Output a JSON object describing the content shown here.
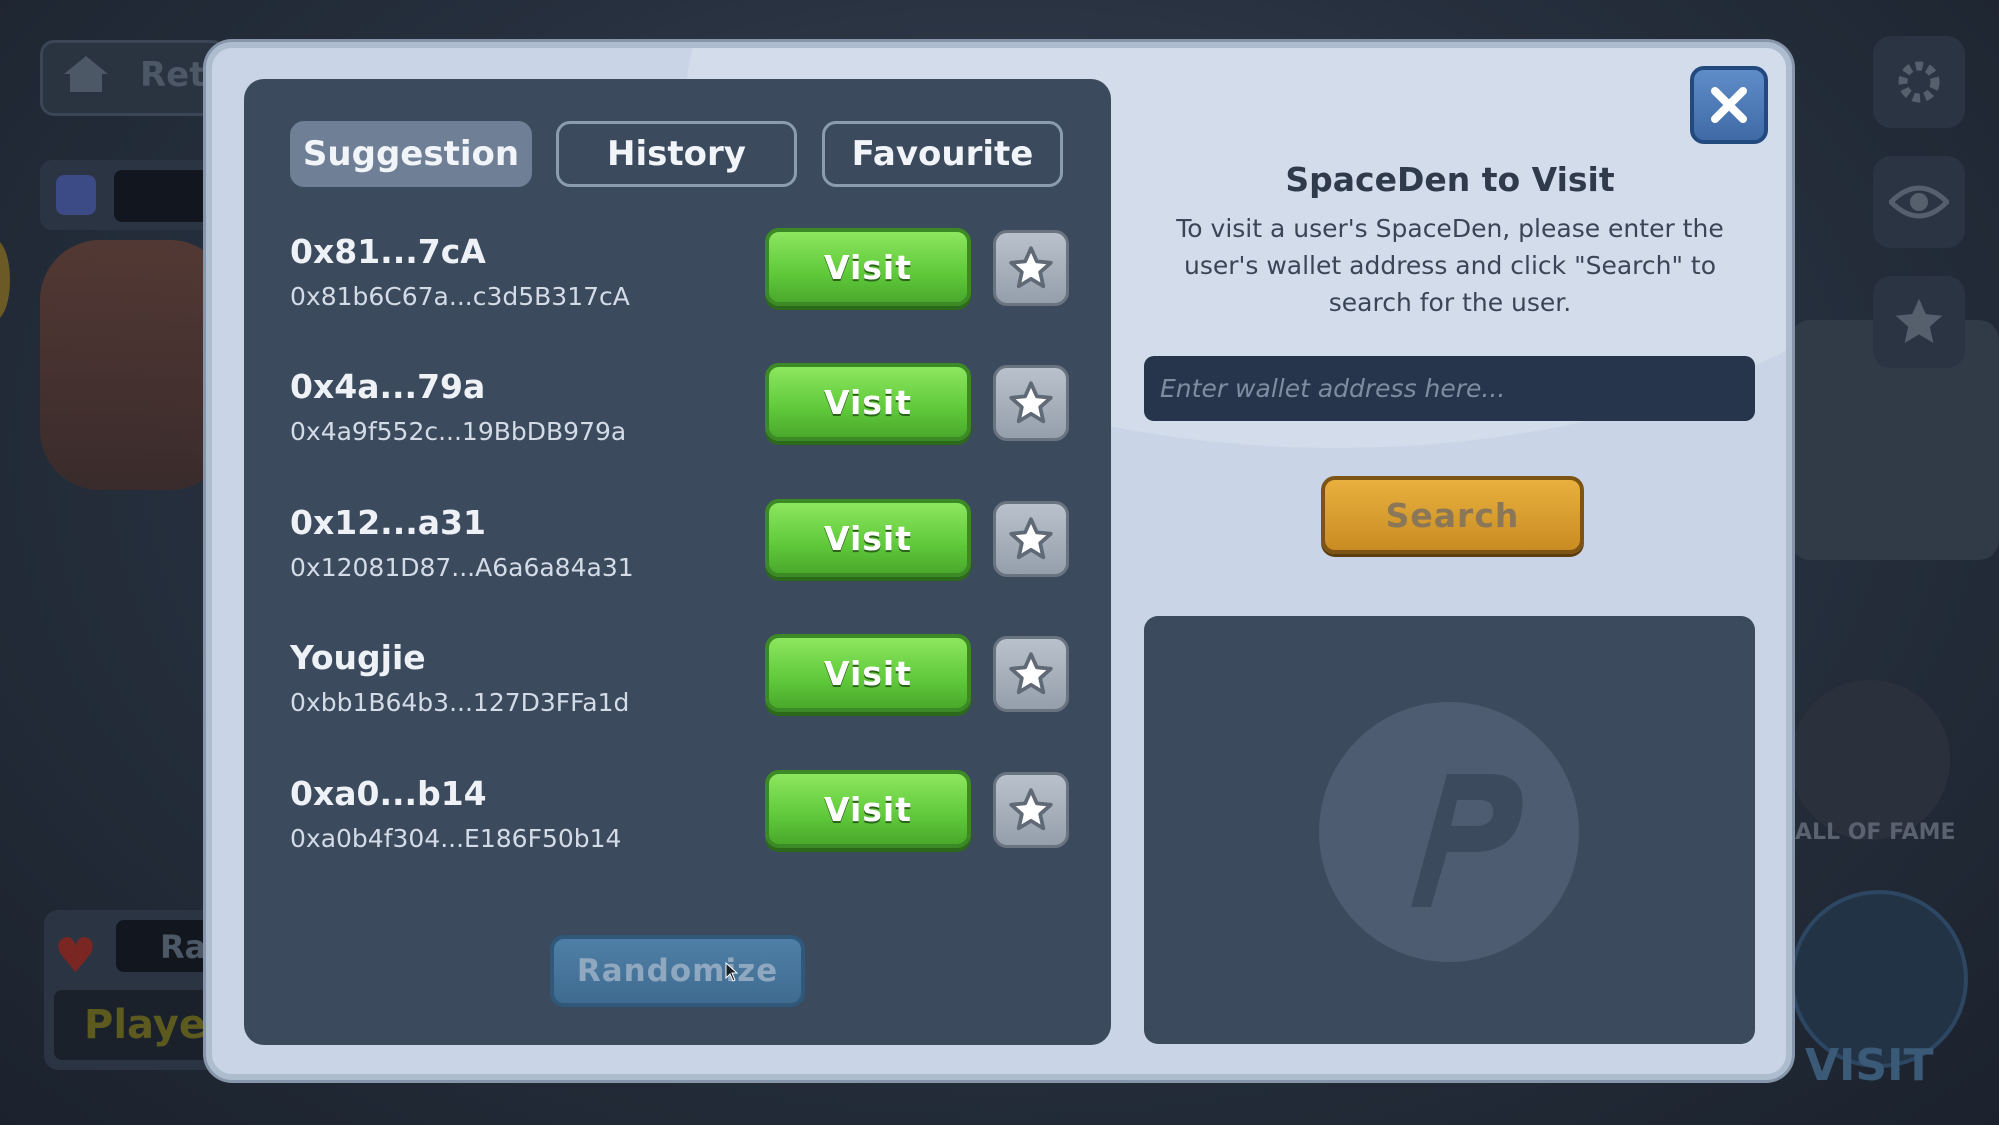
{
  "background": {
    "top_left_label": "Ret",
    "bottom_left_label": "Ra",
    "player_label": "Playe",
    "hall_of_fame_label": "ALL OF FAME",
    "visit_label": "VISIT"
  },
  "tabs": [
    {
      "label": "Suggestion",
      "active": true
    },
    {
      "label": "History",
      "active": false
    },
    {
      "label": "Favourite",
      "active": false
    }
  ],
  "suggestions": [
    {
      "name": "0x81...7cA",
      "address": "0x81b6C67a...c3d5B317cA",
      "visit_label": "Visit"
    },
    {
      "name": "0x4a...79a",
      "address": "0x4a9f552c...19BbDB979a",
      "visit_label": "Visit"
    },
    {
      "name": "0x12...a31",
      "address": "0x12081D87...A6a6a84a31",
      "visit_label": "Visit"
    },
    {
      "name": "Yougjie",
      "address": "0xbb1B64b3...127D3FFa1d",
      "visit_label": "Visit"
    },
    {
      "name": "0xa0...b14",
      "address": "0xa0b4f304...E186F50b14",
      "visit_label": "Visit"
    }
  ],
  "randomize_label": "Randomize",
  "right": {
    "title": "SpaceDen to Visit",
    "description": "To visit a user's SpaceDen, please enter the user's wallet address and click \"Search\" to search for the user.",
    "input_placeholder": "Enter wallet address here...",
    "input_value": "",
    "search_label": "Search"
  },
  "colors": {
    "modal_bg": "#c9d5e6",
    "panel_bg": "#3c4a5d",
    "visit_green": "#5fc93a",
    "search_gold": "#d89c2c",
    "close_blue": "#4f7cb8"
  }
}
